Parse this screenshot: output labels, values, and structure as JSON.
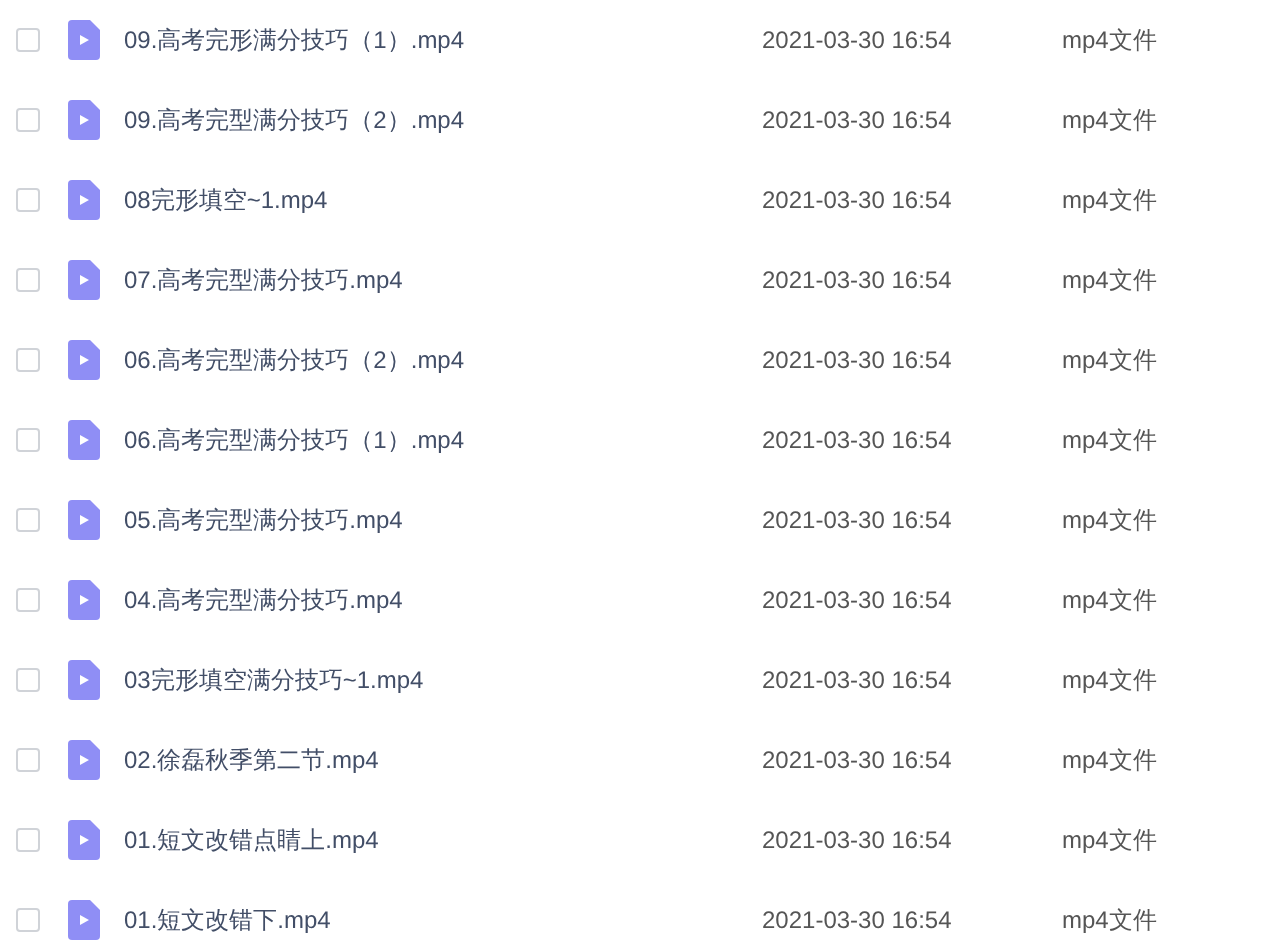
{
  "files": [
    {
      "name": "09.高考完形满分技巧（1）.mp4",
      "modified": "2021-03-30 16:54",
      "type": "mp4文件",
      "checked": false
    },
    {
      "name": "09.高考完型满分技巧（2）.mp4",
      "modified": "2021-03-30 16:54",
      "type": "mp4文件",
      "checked": false
    },
    {
      "name": "08完形填空~1.mp4",
      "modified": "2021-03-30 16:54",
      "type": "mp4文件",
      "checked": false
    },
    {
      "name": "07.高考完型满分技巧.mp4",
      "modified": "2021-03-30 16:54",
      "type": "mp4文件",
      "checked": false
    },
    {
      "name": "06.高考完型满分技巧（2）.mp4",
      "modified": "2021-03-30 16:54",
      "type": "mp4文件",
      "checked": false
    },
    {
      "name": "06.高考完型满分技巧（1）.mp4",
      "modified": "2021-03-30 16:54",
      "type": "mp4文件",
      "checked": false
    },
    {
      "name": "05.高考完型满分技巧.mp4",
      "modified": "2021-03-30 16:54",
      "type": "mp4文件",
      "checked": false
    },
    {
      "name": "04.高考完型满分技巧.mp4",
      "modified": "2021-03-30 16:54",
      "type": "mp4文件",
      "checked": false
    },
    {
      "name": "03完形填空满分技巧~1.mp4",
      "modified": "2021-03-30 16:54",
      "type": "mp4文件",
      "checked": false
    },
    {
      "name": "02.徐磊秋季第二节.mp4",
      "modified": "2021-03-30 16:54",
      "type": "mp4文件",
      "checked": false
    },
    {
      "name": "01.短文改错点睛上.mp4",
      "modified": "2021-03-30 16:54",
      "type": "mp4文件",
      "checked": false
    },
    {
      "name": "01.短文改错下.mp4",
      "modified": "2021-03-30 16:54",
      "type": "mp4文件",
      "checked": false
    }
  ]
}
